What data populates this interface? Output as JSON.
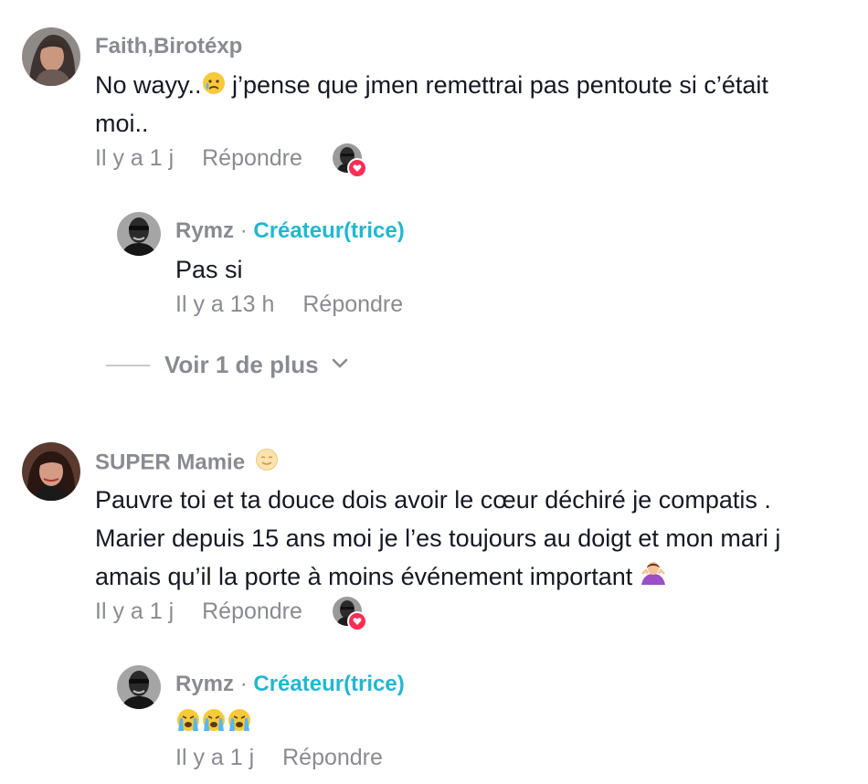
{
  "comments": [
    {
      "username": "Faith,Birotéxp",
      "text_line1": "No wayy..",
      "text_line1_after": " j’pense que jmen remettrai pas pentoute si c’était",
      "text_line2": "moi..",
      "time": "Il y a 1 j",
      "reply_label": "Répondre",
      "replies": [
        {
          "username": "Rymz",
          "separator": " · ",
          "creator_label": "Créateur(trice)",
          "text": "Pas si",
          "time": "Il y a 13 h",
          "reply_label": "Répondre"
        }
      ],
      "more_label": "Voir 1 de plus"
    },
    {
      "username": "SUPER Mamie",
      "text_line1": "Pauvre toi et ta douce dois avoir le cœur déchiré je compatis .",
      "text_line2": "Marier depuis 15 ans moi je l’es toujours au doigt et mon mari j",
      "text_line3": "amais qu’il la porte à moins événement important",
      "time": "Il y a 1 j",
      "reply_label": "Répondre",
      "replies": [
        {
          "username": "Rymz",
          "separator": " · ",
          "creator_label": "Créateur(trice)",
          "time": "Il y a 1 j",
          "reply_label": "Répondre"
        }
      ]
    }
  ],
  "icons": {
    "heart_badge": "heart-icon",
    "chevron": "chevron-down-icon",
    "emoji_sad": "sad-but-relieved-face-emoji",
    "emoji_smile": "smiling-face-emoji",
    "emoji_shrug": "woman-shrugging-emoji",
    "emoji_cry": "loudly-crying-face-emoji"
  },
  "colors": {
    "creator": "#20b8cf",
    "muted": "#8a8b91",
    "text": "#161823",
    "like_badge": "#fe2c55"
  }
}
